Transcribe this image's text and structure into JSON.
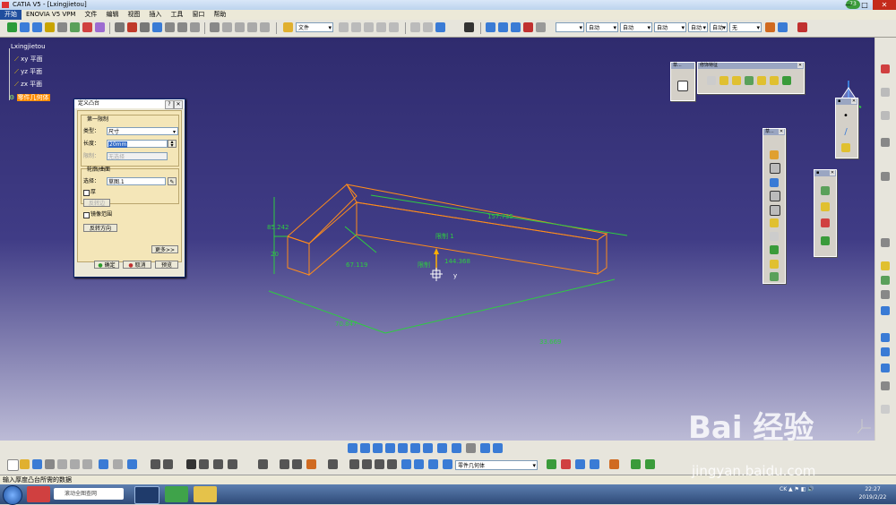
{
  "window": {
    "title": "CATIA V5 - [Lxingjietou]",
    "badge": "73",
    "min": "—",
    "max": "□",
    "close": "✕"
  },
  "menu": [
    "开始",
    "ENOVIA V5 VPM",
    "文件",
    "编辑",
    "视图",
    "插入",
    "工具",
    "窗口",
    "帮助"
  ],
  "toolbar": {
    "combo_file": "文件",
    "combo_auto1": "自动",
    "combo_auto2": "自动",
    "combo_auto3": "自动",
    "combo_auto4": "自动",
    "combo_auto5": "自动",
    "combo_none": "无"
  },
  "tree": {
    "root": "Lxingjietou",
    "planes": [
      "xy 平面",
      "yz 平面",
      "zx 平面"
    ],
    "body": "零件几何体"
  },
  "dialog": {
    "title": "定义凸台",
    "help": "?",
    "close": "✕",
    "first_limit": "第一限制",
    "type_label": "类型：",
    "type_value": "尺寸",
    "length_label": "长度：",
    "length_value": "20mm",
    "limit_label": "限制：",
    "limit_value": "无选择",
    "profile_group": "轮廓/曲面",
    "select_label": "选择：",
    "select_value": "草图.1",
    "thick_label": "厚",
    "reverse_side": "反转边",
    "mirror_label": "镜像范围",
    "reverse_dir": "反转方向",
    "more": "更多>>",
    "ok": "确定",
    "cancel": "取消",
    "preview": "预览"
  },
  "palettes": {
    "feature_title": "修饰特征",
    "small_title": "草..."
  },
  "dims": {
    "d1": "85.242",
    "d2": "20",
    "d3": "67.119",
    "d4": "70.847",
    "d5": "33.669",
    "d6": "157.735",
    "d7": "144.368",
    "limit1": "限制 1",
    "limit2": "限制",
    "axis_y": "y"
  },
  "bottom": {
    "part_combo": "零件几何体"
  },
  "status": {
    "text": "输入厚度凸台所需的数据"
  },
  "taskbar": {
    "search": "滚动全图查网",
    "lang": "CK",
    "time": "22:27",
    "date": "2019/2/22"
  },
  "watermark": {
    "brand": "Bai  经验",
    "url": "jingyan.baidu.com"
  },
  "colors": {
    "viewport_top": "#2f2b6e",
    "part_edge": "#ff8c1a",
    "dimension": "#2ecc40",
    "accent_orange": "#ff8c00"
  }
}
